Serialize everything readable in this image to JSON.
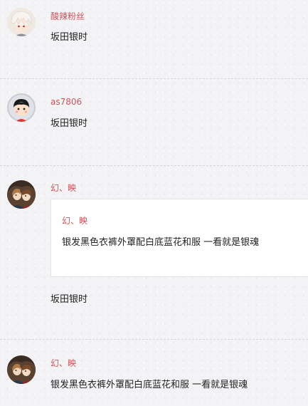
{
  "comments": [
    {
      "user": "酸辣粉丝",
      "text": "坂田银时",
      "avatar_icon": "white-haired-anime-avatar-icon"
    },
    {
      "user": "as7806",
      "text": "坂田银时",
      "avatar_icon": "cartoon-boy-avatar-icon"
    },
    {
      "user": "幻、映",
      "quote": {
        "user": "幻、映",
        "text": "银发黑色衣裤外罩配白底蓝花和服 一看就是银魂"
      },
      "text": "坂田银时",
      "avatar_icon": "anime-pair-avatar-icon"
    },
    {
      "user": "幻、映",
      "text": "银发黑色衣裤外罩配白底蓝花和服 一看就是银魂",
      "avatar_icon": "anime-pair-avatar-icon"
    }
  ],
  "colors": {
    "username": "#d0555c",
    "text": "#222222",
    "background": "#f3f3f5",
    "quote_background": "#ffffff"
  }
}
